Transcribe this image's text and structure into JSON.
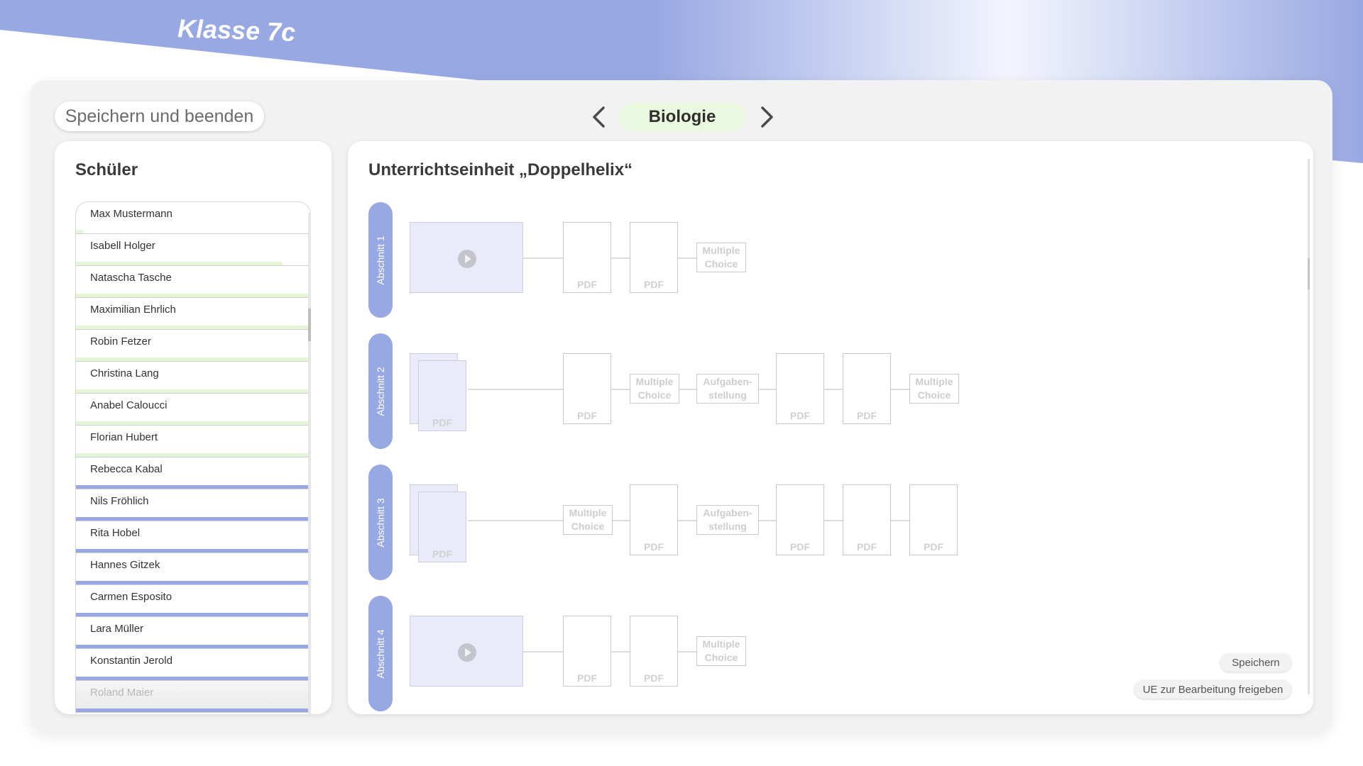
{
  "header": {
    "class_title": "Klasse 7c"
  },
  "toolbar": {
    "save_exit_label": "Speichern und beenden",
    "subject": "Biologie",
    "prev_icon": "chevron-left-icon",
    "next_icon": "chevron-right-icon"
  },
  "students_panel": {
    "heading": "Schüler",
    "students": [
      {
        "name": "Max Mustermann",
        "progress": 0.03,
        "status": "active"
      },
      {
        "name": "Isabell Holger",
        "progress": 0.88,
        "status": "active"
      },
      {
        "name": "Natascha Tasche",
        "progress": 1.0,
        "status": "active"
      },
      {
        "name": "Maximilian Ehrlich",
        "progress": 1.0,
        "status": "active"
      },
      {
        "name": "Robin Fetzer",
        "progress": 1.0,
        "status": "active"
      },
      {
        "name": "Christina Lang",
        "progress": 1.0,
        "status": "active"
      },
      {
        "name": "Anabel Caloucci",
        "progress": 1.0,
        "status": "active"
      },
      {
        "name": "Florian Hubert",
        "progress": 1.0,
        "status": "active"
      },
      {
        "name": "Rebecca Kabal",
        "progress": 1.0,
        "status": "complete"
      },
      {
        "name": "Nils Fröhlich",
        "progress": 1.0,
        "status": "complete"
      },
      {
        "name": "Rita Hobel",
        "progress": 1.0,
        "status": "complete"
      },
      {
        "name": "Hannes Gitzek",
        "progress": 1.0,
        "status": "complete"
      },
      {
        "name": "Carmen Esposito",
        "progress": 1.0,
        "status": "complete"
      },
      {
        "name": "Lara Müller",
        "progress": 1.0,
        "status": "complete"
      },
      {
        "name": "Konstantin Jerold",
        "progress": 1.0,
        "status": "complete"
      },
      {
        "name": "Roland Maier",
        "progress": 1.0,
        "status": "complete"
      }
    ]
  },
  "colors": {
    "accent": "#98a8e2",
    "active_progress": "#e3f6d6",
    "complete_progress": "#98a8e2",
    "subject_pill": "#e9f8df"
  },
  "unit": {
    "title": "Unterrichtseinheit „Doppelhelix“",
    "sections": [
      {
        "label": "Abschnitt 1",
        "items": [
          {
            "type": "video",
            "icon": "play-icon"
          },
          {
            "type": "pdf",
            "label": "PDF"
          },
          {
            "type": "pdf",
            "label": "PDF"
          },
          {
            "type": "text",
            "label": "Multiple\nChoice"
          }
        ]
      },
      {
        "label": "Abschnitt 2",
        "items": [
          {
            "type": "pdf-stack",
            "label": "PDF"
          },
          {
            "type": "pdf",
            "label": "PDF"
          },
          {
            "type": "text",
            "label": "Multiple\nChoice"
          },
          {
            "type": "text",
            "label": "Aufgaben-\nstellung"
          },
          {
            "type": "pdf",
            "label": "PDF"
          },
          {
            "type": "pdf",
            "label": "PDF"
          },
          {
            "type": "text",
            "label": "Multiple\nChoice"
          }
        ]
      },
      {
        "label": "Abschnitt 3",
        "items": [
          {
            "type": "pdf-stack",
            "label": "PDF"
          },
          {
            "type": "text",
            "label": "Multiple\nChoice"
          },
          {
            "type": "pdf",
            "label": "PDF"
          },
          {
            "type": "text",
            "label": "Aufgaben-\nstellung"
          },
          {
            "type": "pdf",
            "label": "PDF"
          },
          {
            "type": "pdf",
            "label": "PDF"
          },
          {
            "type": "pdf",
            "label": "PDF"
          }
        ]
      },
      {
        "label": "Abschnitt 4",
        "items": [
          {
            "type": "video",
            "icon": "play-icon"
          },
          {
            "type": "pdf",
            "label": "PDF"
          },
          {
            "type": "pdf",
            "label": "PDF"
          },
          {
            "type": "text",
            "label": "Multiple\nChoice"
          }
        ]
      }
    ]
  },
  "actions": {
    "save_label": "Speichern",
    "release_label": "UE zur Bearbeitung freigeben"
  }
}
